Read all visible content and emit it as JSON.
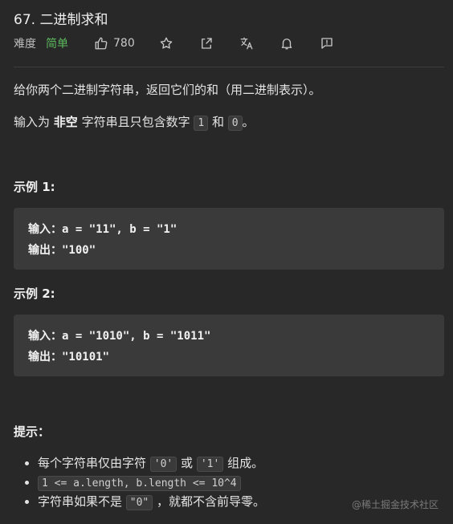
{
  "problem": {
    "title": "67. 二进制求和",
    "difficulty_label": "难度",
    "difficulty_value": "简单",
    "likes": "780",
    "difficulty_color": "#5bb85d"
  },
  "toolbar": {
    "icons": [
      "thumbs-up-icon",
      "star-icon",
      "share-icon",
      "translate-icon",
      "bell-icon",
      "feedback-icon"
    ]
  },
  "description": {
    "p1": "给你两个二进制字符串，返回它们的和（用二进制表示）。",
    "p2_prefix": "输入为 ",
    "p2_bold": "非空",
    "p2_middle": " 字符串且只包含数字 ",
    "p2_code1": "1",
    "p2_and": " 和 ",
    "p2_code2": "0",
    "p2_suffix": "。"
  },
  "examples": [
    {
      "heading": "示例 1:",
      "input_label": "输入：",
      "input_value": "a = \"11\", b = \"1\"",
      "output_label": "输出：",
      "output_value": "\"100\""
    },
    {
      "heading": "示例 2:",
      "input_label": "输入：",
      "input_value": "a = \"1010\", b = \"1011\"",
      "output_label": "输出：",
      "output_value": "\"10101\""
    }
  ],
  "hints": {
    "heading": "提示：",
    "h1_prefix": "每个字符串仅由字符 ",
    "h1_code1": "'0'",
    "h1_or": " 或 ",
    "h1_code2": "'1'",
    "h1_suffix": " 组成。",
    "h2_code": "1 <= a.length, b.length <= 10^4",
    "h3_prefix": "字符串如果不是 ",
    "h3_code": "\"0\"",
    "h3_suffix": " ，就都不含前导零。"
  },
  "watermark": "@稀土掘金技术社区"
}
